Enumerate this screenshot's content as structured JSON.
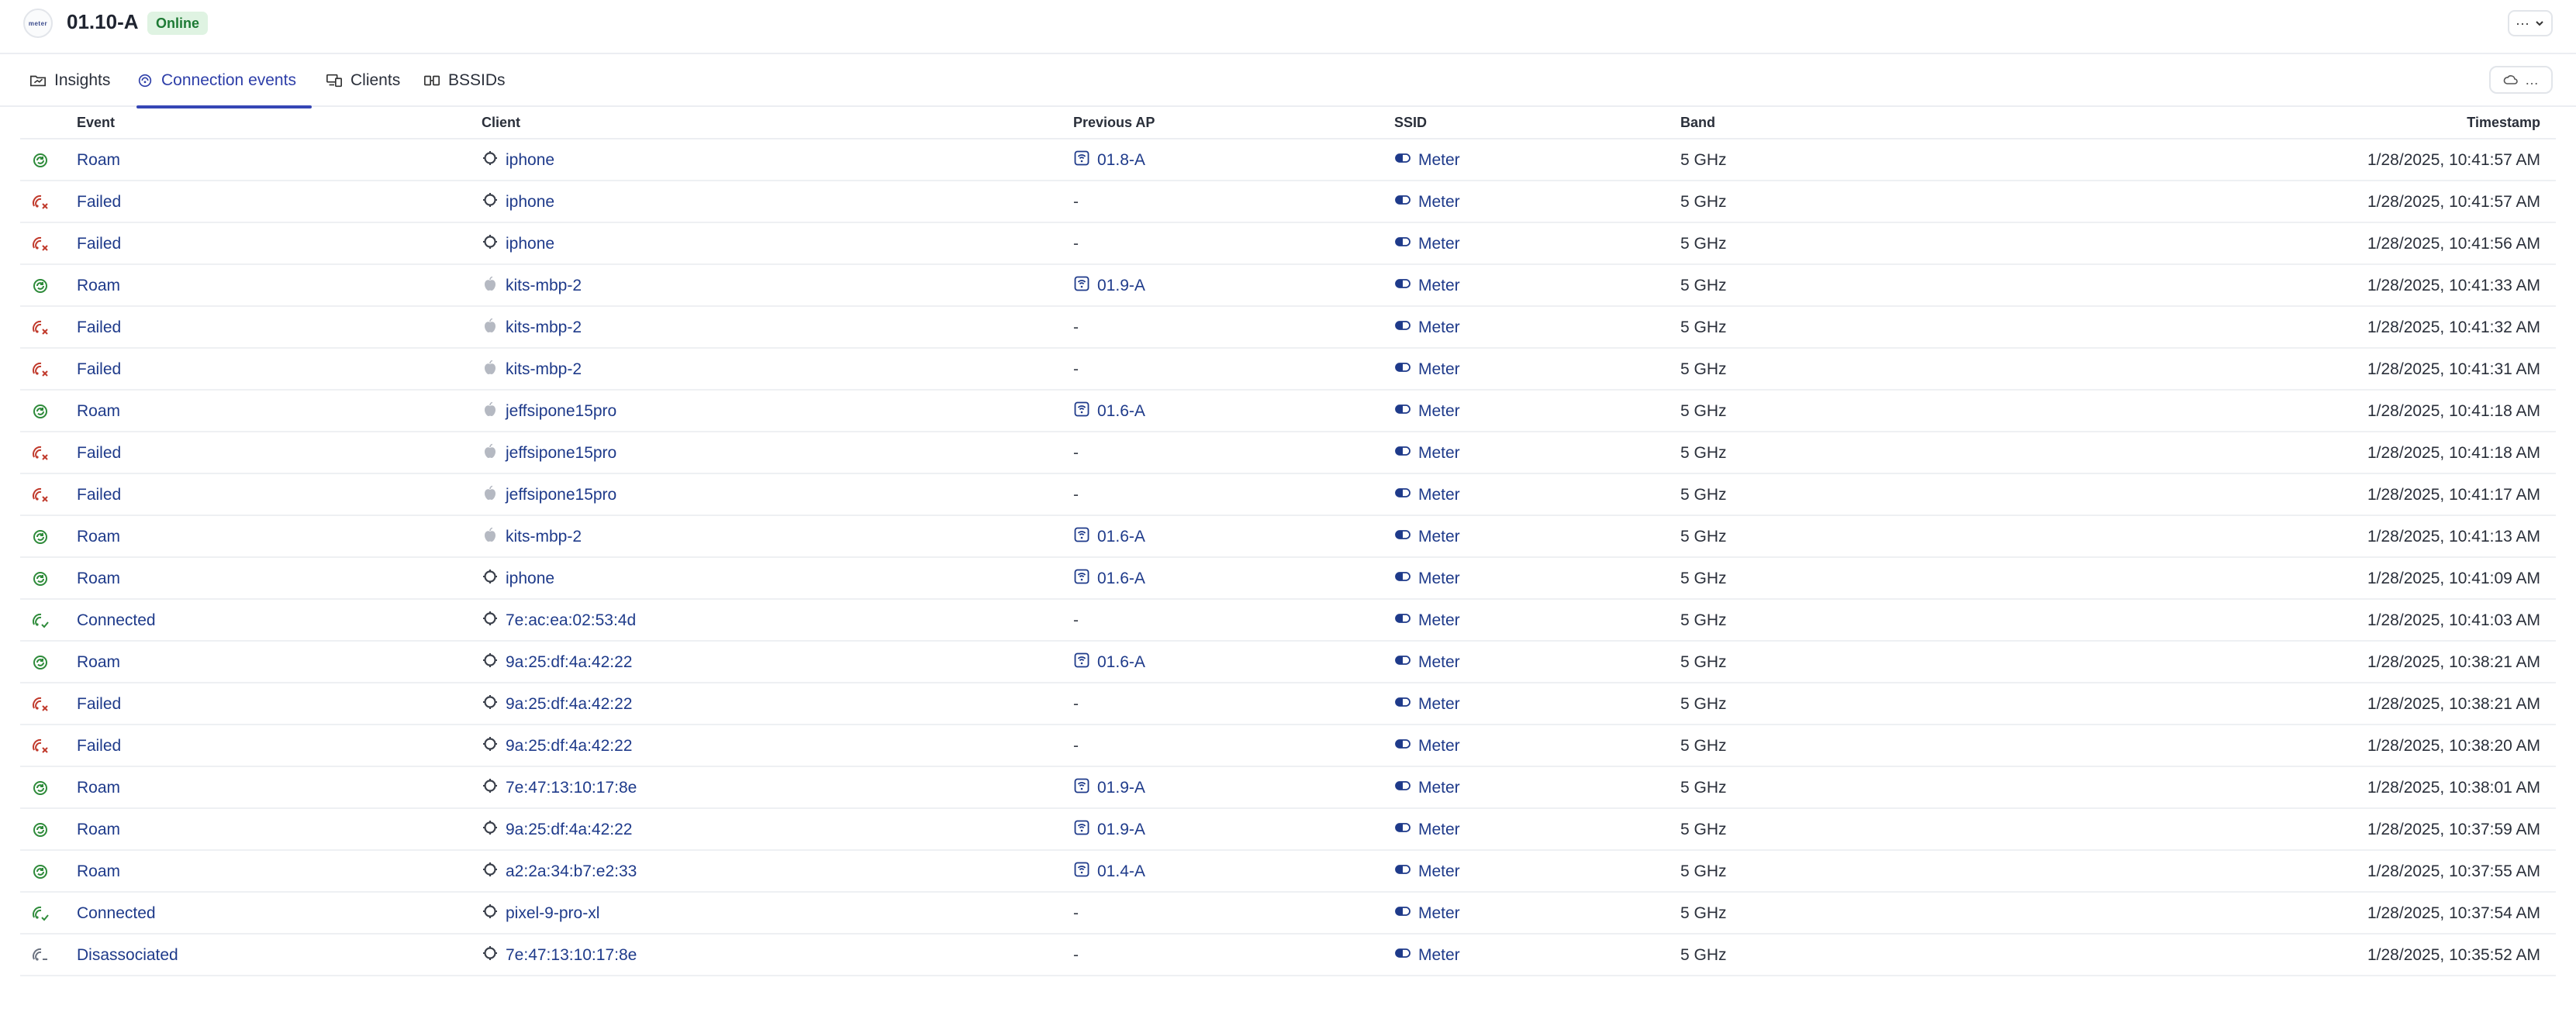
{
  "header": {
    "title": "01.10-A",
    "status": "Online",
    "logo_text": "meter"
  },
  "tabs": [
    {
      "label": "Insights",
      "icon": "folder-chart-icon"
    },
    {
      "label": "Connection events",
      "icon": "connection-icon",
      "active": true
    },
    {
      "label": "Clients",
      "icon": "clients-icon"
    },
    {
      "label": "BSSIDs",
      "icon": "bssid-icon"
    }
  ],
  "columns": {
    "event": "Event",
    "client": "Client",
    "previous_ap": "Previous AP",
    "ssid": "SSID",
    "band": "Band",
    "timestamp": "Timestamp"
  },
  "rows": [
    {
      "event": "Roam",
      "type": "roam",
      "client": "iphone",
      "client_icon": "generic",
      "prev_ap": "01.8-A",
      "ssid": "Meter",
      "band": "5 GHz",
      "timestamp": "1/28/2025, 10:41:57 AM"
    },
    {
      "event": "Failed",
      "type": "failed",
      "client": "iphone",
      "client_icon": "generic",
      "prev_ap": "-",
      "ssid": "Meter",
      "band": "5 GHz",
      "timestamp": "1/28/2025, 10:41:57 AM"
    },
    {
      "event": "Failed",
      "type": "failed",
      "client": "iphone",
      "client_icon": "generic",
      "prev_ap": "-",
      "ssid": "Meter",
      "band": "5 GHz",
      "timestamp": "1/28/2025, 10:41:56 AM"
    },
    {
      "event": "Roam",
      "type": "roam",
      "client": "kits-mbp-2",
      "client_icon": "apple",
      "prev_ap": "01.9-A",
      "ssid": "Meter",
      "band": "5 GHz",
      "timestamp": "1/28/2025, 10:41:33 AM"
    },
    {
      "event": "Failed",
      "type": "failed",
      "client": "kits-mbp-2",
      "client_icon": "apple",
      "prev_ap": "-",
      "ssid": "Meter",
      "band": "5 GHz",
      "timestamp": "1/28/2025, 10:41:32 AM"
    },
    {
      "event": "Failed",
      "type": "failed",
      "client": "kits-mbp-2",
      "client_icon": "apple",
      "prev_ap": "-",
      "ssid": "Meter",
      "band": "5 GHz",
      "timestamp": "1/28/2025, 10:41:31 AM"
    },
    {
      "event": "Roam",
      "type": "roam",
      "client": "jeffsipone15pro",
      "client_icon": "apple",
      "prev_ap": "01.6-A",
      "ssid": "Meter",
      "band": "5 GHz",
      "timestamp": "1/28/2025, 10:41:18 AM"
    },
    {
      "event": "Failed",
      "type": "failed",
      "client": "jeffsipone15pro",
      "client_icon": "apple",
      "prev_ap": "-",
      "ssid": "Meter",
      "band": "5 GHz",
      "timestamp": "1/28/2025, 10:41:18 AM"
    },
    {
      "event": "Failed",
      "type": "failed",
      "client": "jeffsipone15pro",
      "client_icon": "apple",
      "prev_ap": "-",
      "ssid": "Meter",
      "band": "5 GHz",
      "timestamp": "1/28/2025, 10:41:17 AM"
    },
    {
      "event": "Roam",
      "type": "roam",
      "client": "kits-mbp-2",
      "client_icon": "apple",
      "prev_ap": "01.6-A",
      "ssid": "Meter",
      "band": "5 GHz",
      "timestamp": "1/28/2025, 10:41:13 AM"
    },
    {
      "event": "Roam",
      "type": "roam",
      "client": "iphone",
      "client_icon": "generic",
      "prev_ap": "01.6-A",
      "ssid": "Meter",
      "band": "5 GHz",
      "timestamp": "1/28/2025, 10:41:09 AM"
    },
    {
      "event": "Connected",
      "type": "connected",
      "client": "7e:ac:ea:02:53:4d",
      "client_icon": "generic",
      "prev_ap": "-",
      "ssid": "Meter",
      "band": "5 GHz",
      "timestamp": "1/28/2025, 10:41:03 AM"
    },
    {
      "event": "Roam",
      "type": "roam",
      "client": "9a:25:df:4a:42:22",
      "client_icon": "generic",
      "prev_ap": "01.6-A",
      "ssid": "Meter",
      "band": "5 GHz",
      "timestamp": "1/28/2025, 10:38:21 AM"
    },
    {
      "event": "Failed",
      "type": "failed",
      "client": "9a:25:df:4a:42:22",
      "client_icon": "generic",
      "prev_ap": "-",
      "ssid": "Meter",
      "band": "5 GHz",
      "timestamp": "1/28/2025, 10:38:21 AM"
    },
    {
      "event": "Failed",
      "type": "failed",
      "client": "9a:25:df:4a:42:22",
      "client_icon": "generic",
      "prev_ap": "-",
      "ssid": "Meter",
      "band": "5 GHz",
      "timestamp": "1/28/2025, 10:38:20 AM"
    },
    {
      "event": "Roam",
      "type": "roam",
      "client": "7e:47:13:10:17:8e",
      "client_icon": "generic",
      "prev_ap": "01.9-A",
      "ssid": "Meter",
      "band": "5 GHz",
      "timestamp": "1/28/2025, 10:38:01 AM"
    },
    {
      "event": "Roam",
      "type": "roam",
      "client": "9a:25:df:4a:42:22",
      "client_icon": "generic",
      "prev_ap": "01.9-A",
      "ssid": "Meter",
      "band": "5 GHz",
      "timestamp": "1/28/2025, 10:37:59 AM"
    },
    {
      "event": "Roam",
      "type": "roam",
      "client": "a2:2a:34:b7:e2:33",
      "client_icon": "generic",
      "prev_ap": "01.4-A",
      "ssid": "Meter",
      "band": "5 GHz",
      "timestamp": "1/28/2025, 10:37:55 AM"
    },
    {
      "event": "Connected",
      "type": "connected",
      "client": "pixel-9-pro-xl",
      "client_icon": "generic",
      "prev_ap": "-",
      "ssid": "Meter",
      "band": "5 GHz",
      "timestamp": "1/28/2025, 10:37:54 AM"
    },
    {
      "event": "Disassociated",
      "type": "disassociated",
      "client": "7e:47:13:10:17:8e",
      "client_icon": "generic",
      "prev_ap": "-",
      "ssid": "Meter",
      "band": "5 GHz",
      "timestamp": "1/28/2025, 10:35:52 AM"
    }
  ],
  "colors": {
    "link": "#1e3a8a",
    "roam": "#2e8b3a",
    "failed": "#c0392b",
    "connected": "#2e8b3a",
    "disassociated": "#6b7280",
    "accent": "#3546b5"
  }
}
